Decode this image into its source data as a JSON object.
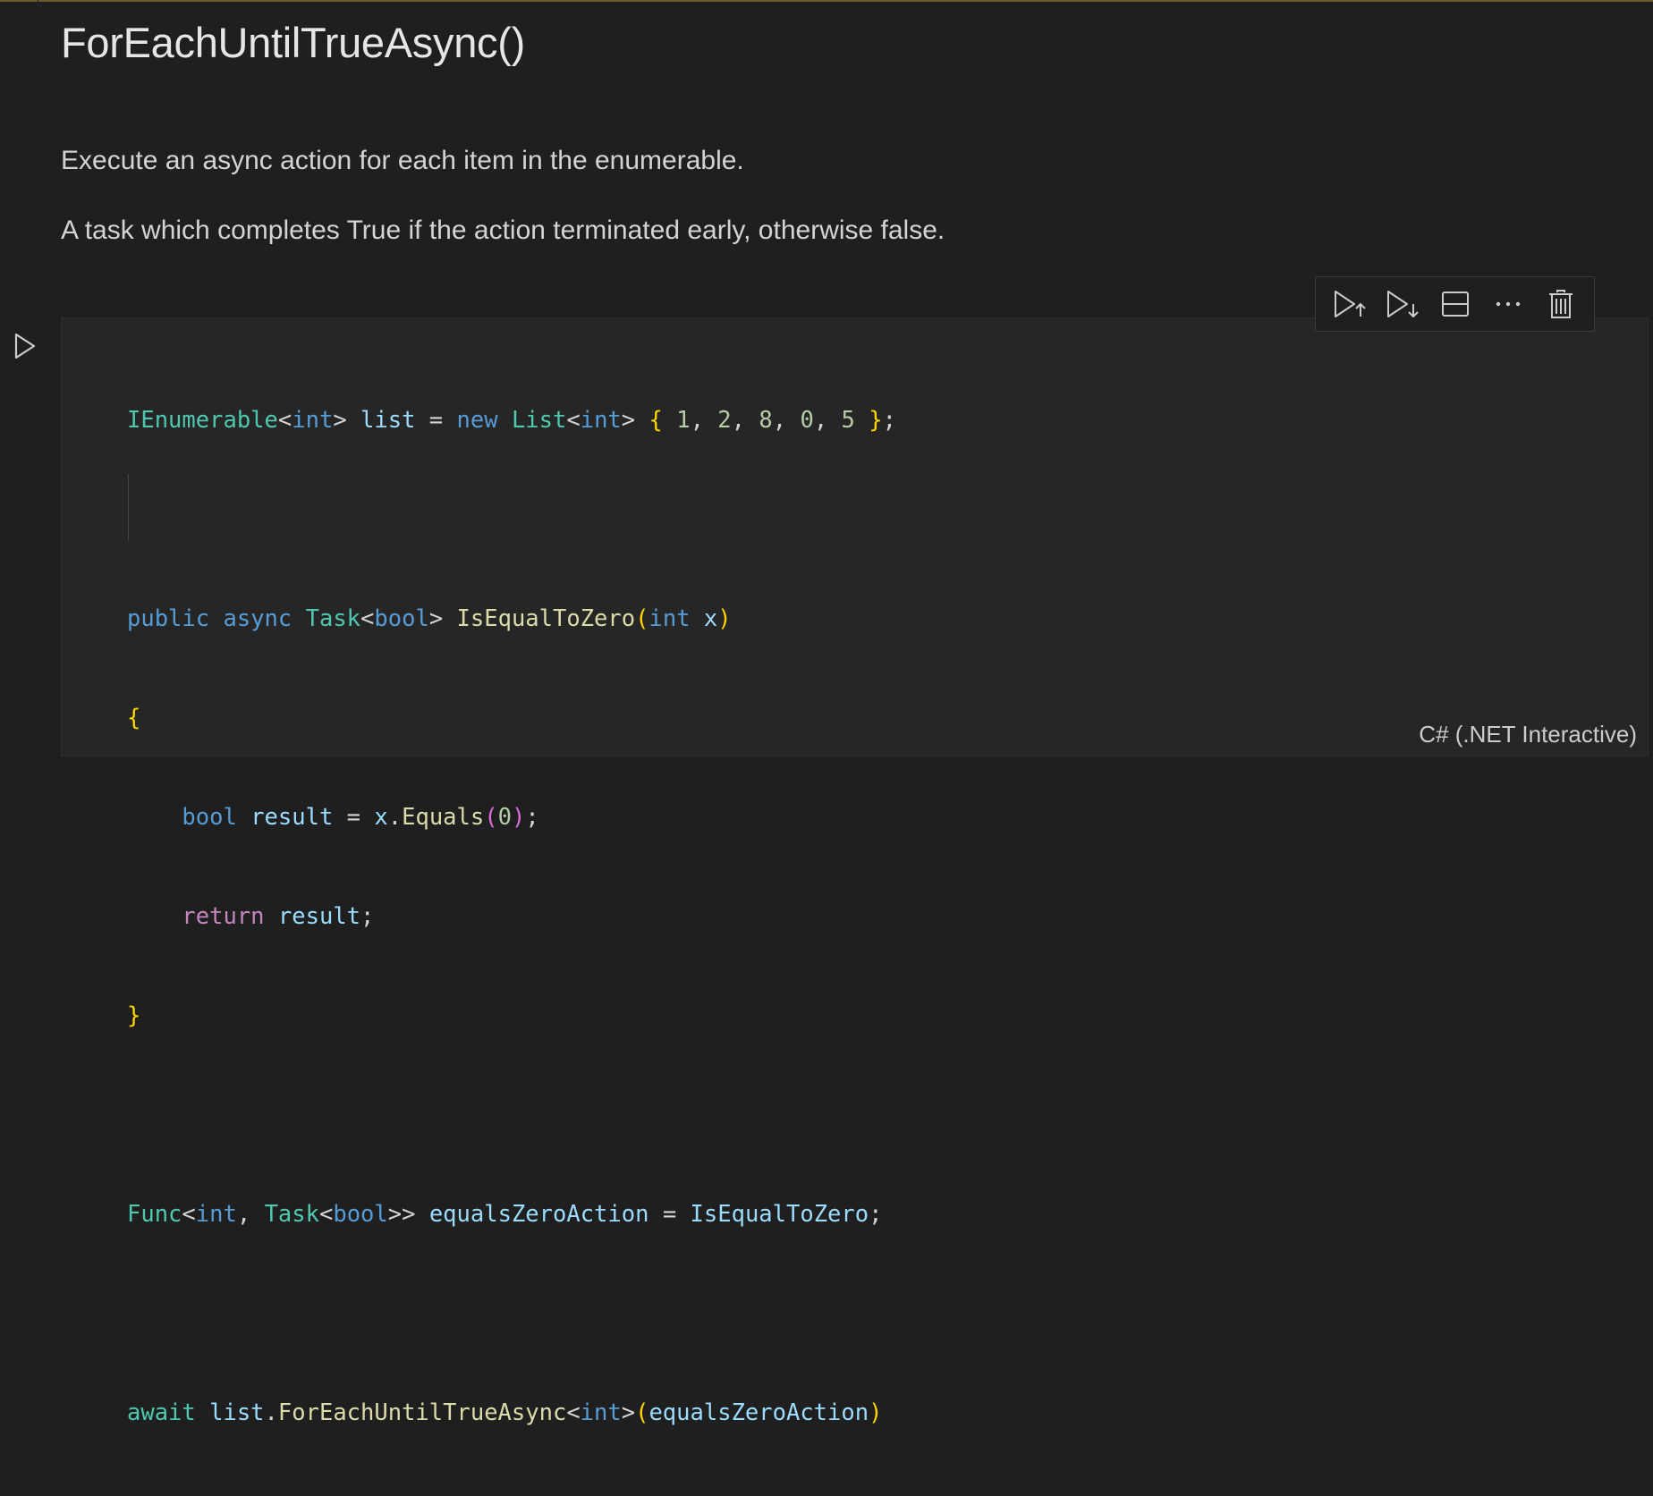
{
  "markdown": {
    "title": "ForEachUntilTrueAsync()",
    "paragraph1": "Execute an async action for each item in the enumerable.",
    "paragraph2": "A task which completes True if the action terminated early, otherwise false."
  },
  "cell": {
    "language": "C# (.NET Interactive)",
    "code_lines": [
      "IEnumerable<int> list = new List<int> { 1, 2, 8, 0, 5 };",
      "",
      "public async Task<bool> IsEqualToZero(int x)",
      "{",
      "    bool result = x.Equals(0);",
      "    return result;",
      "}",
      "",
      "Func<int, Task<bool>> equalsZeroAction = IsEqualToZero;",
      "",
      "await list.ForEachUntilTrueAsync<int>(equalsZeroAction)"
    ]
  },
  "toolbar": {
    "items": [
      "execute-above-icon",
      "execute-below-icon",
      "split-cell-icon",
      "more-actions-icon",
      "delete-icon"
    ]
  },
  "icons": {
    "run": "run-cell-icon"
  },
  "colors": {
    "background": "#1f1f1f",
    "cell_background": "#262626",
    "keyword": "#569cd6",
    "type": "#4ec9b0",
    "function": "#dcdcaa",
    "variable": "#9cdcfe",
    "number": "#b5cea8",
    "control": "#c586c0",
    "bracket_gold": "#ffd700",
    "bracket_pink": "#da70d6"
  }
}
